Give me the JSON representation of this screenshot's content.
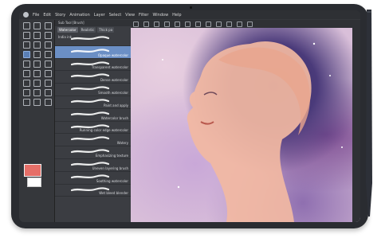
{
  "menu": {
    "items": [
      "File",
      "Edit",
      "Story",
      "Animation",
      "Layer",
      "Select",
      "View",
      "Filter",
      "Window",
      "Help"
    ]
  },
  "brush_panel": {
    "header": "Sub Tool [Brush]",
    "tabs": [
      "Watercolor",
      "Realistic",
      "Thick pa"
    ],
    "brushes": [
      {
        "label": "India ink",
        "stroke_color": "#ffffff"
      },
      {
        "label": "Opaque watercolor",
        "stroke_color": "#ffffff"
      },
      {
        "label": "Transparent watercolor",
        "stroke_color": "#ffffff"
      },
      {
        "label": "Dense watercolor",
        "stroke_color": "#ffffff"
      },
      {
        "label": "Smooth watercolor",
        "stroke_color": "#ffffff"
      },
      {
        "label": "Paint and apply",
        "stroke_color": "#ffffff"
      },
      {
        "label": "Watercolor brush",
        "stroke_color": "#ffffff"
      },
      {
        "label": "Running color edge watercolor",
        "stroke_color": "#ffffff"
      },
      {
        "label": "Watery",
        "stroke_color": "#ffffff"
      },
      {
        "label": "Emphasizing texture",
        "stroke_color": "#ffffff"
      },
      {
        "label": "Uneven layering brush",
        "stroke_color": "#ffffff"
      },
      {
        "label": "Soothing watercolor",
        "stroke_color": "#ffffff"
      },
      {
        "label": "Wet bleed blender",
        "stroke_color": "#ffffff"
      }
    ],
    "selected_index": 1
  },
  "colors": {
    "main_color": "#e66f68",
    "sub_color": "#ffffff",
    "accent": "#6b8fc5"
  }
}
